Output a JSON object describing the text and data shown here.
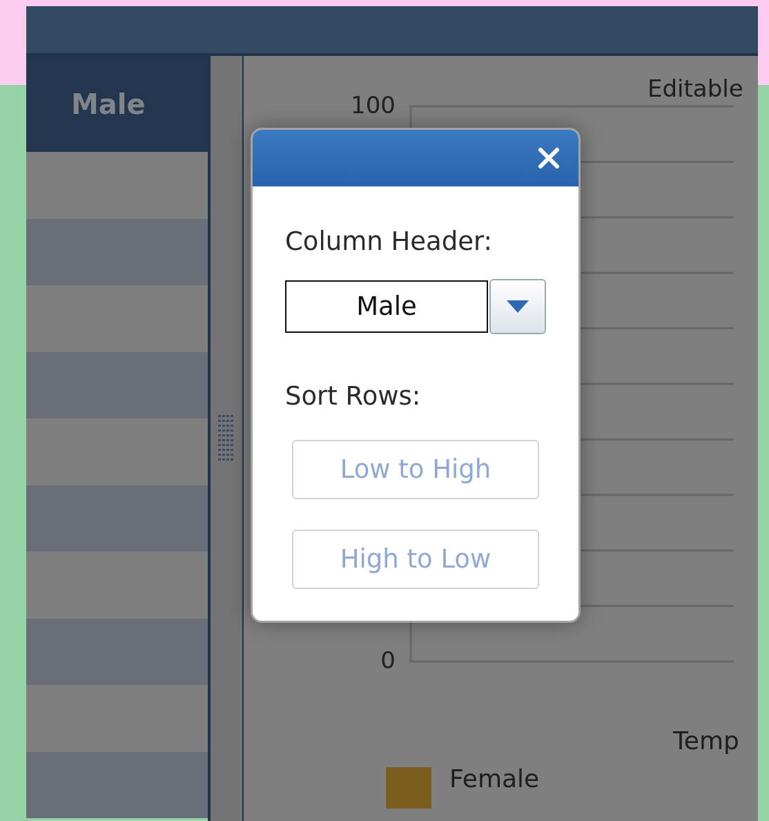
{
  "table": {
    "column_header": "Male"
  },
  "chart": {
    "title": "Editable",
    "y_tick_labels": [
      "100",
      "0"
    ],
    "xlabel": "Temp",
    "legend": [
      {
        "label": "Female",
        "color": "#7b5e1e"
      }
    ]
  },
  "dialog": {
    "field_label": "Column Header:",
    "field_value": "Male",
    "sort_label": "Sort Rows:",
    "buttons": [
      "Low to High",
      "High to Low"
    ]
  }
}
